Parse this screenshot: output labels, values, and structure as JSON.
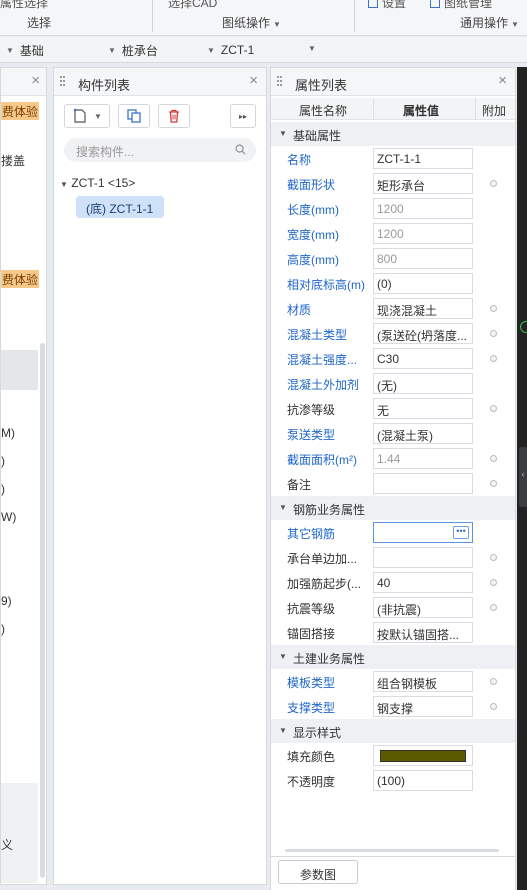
{
  "toolbar": {
    "cut_left": "属性选择",
    "cut_mid": "选择CAD",
    "cut_right1": "设置",
    "cut_right2": "图纸管理",
    "group_select": "选择",
    "group_drawing": "图纸操作",
    "group_general": "通用操作"
  },
  "selectors": {
    "sel1": "基础",
    "sel2": "桩承台",
    "sel3": "ZCT-1"
  },
  "left_panel": {
    "badge1": "费体验",
    "text1": "搂盖",
    "badge2": "费体验",
    "list": [
      "M)",
      ")",
      ")",
      "W)",
      "9)",
      ")"
    ],
    "bottom_text": "义"
  },
  "component_list": {
    "title": "构件列表",
    "search_placeholder": "搜索构件...",
    "tree_root": "ZCT-1 <15>",
    "tree_child": "(底) ZCT-1-1"
  },
  "property_list": {
    "title": "属性列表",
    "col_name": "属性名称",
    "col_value": "属性值",
    "col_extra": "附加",
    "rows": [
      {
        "type": "section",
        "title": "基础属性"
      },
      {
        "label": "名称",
        "value": "ZCT-1-1",
        "blue": true,
        "gray": false,
        "dot": false
      },
      {
        "label": "截面形状",
        "value": "矩形承台",
        "blue": true,
        "gray": false,
        "dot": true
      },
      {
        "label": "长度(mm)",
        "value": "1200",
        "blue": true,
        "gray": true,
        "dot": false
      },
      {
        "label": "宽度(mm)",
        "value": "1200",
        "blue": true,
        "gray": true,
        "dot": false
      },
      {
        "label": "高度(mm)",
        "value": "800",
        "blue": true,
        "gray": true,
        "dot": false
      },
      {
        "label": "相对底标高(m)",
        "value": "(0)",
        "blue": true,
        "gray": false,
        "dot": false
      },
      {
        "label": "材质",
        "value": "现浇混凝土",
        "blue": true,
        "gray": false,
        "dot": true
      },
      {
        "label": "混凝土类型",
        "value": "(泵送砼(坍落度...",
        "blue": true,
        "gray": false,
        "dot": true
      },
      {
        "label": "混凝土强度...",
        "value": "C30",
        "blue": true,
        "gray": false,
        "dot": true
      },
      {
        "label": "混凝土外加剂",
        "value": "(无)",
        "blue": true,
        "gray": false,
        "dot": false
      },
      {
        "label": "抗渗等级",
        "value": "无",
        "blue": false,
        "gray": false,
        "dot": true
      },
      {
        "label": "泵送类型",
        "value": "(混凝土泵)",
        "blue": true,
        "gray": false,
        "dot": false
      },
      {
        "label": "截面面积(m²)",
        "value": "1.44",
        "blue": true,
        "gray": true,
        "dot": true
      },
      {
        "label": "备注",
        "value": "",
        "blue": false,
        "gray": false,
        "dot": true
      },
      {
        "type": "section",
        "title": "钢筋业务属性"
      },
      {
        "label": "其它钢筋",
        "value": "",
        "blue": true,
        "gray": false,
        "dot": false,
        "active": true
      },
      {
        "label": "承台单边加...",
        "value": "",
        "blue": false,
        "gray": false,
        "dot": true
      },
      {
        "label": "加强筋起步(...",
        "value": "40",
        "blue": false,
        "gray": false,
        "dot": true
      },
      {
        "label": "抗震等级",
        "value": "(非抗震)",
        "blue": false,
        "gray": false,
        "dot": true
      },
      {
        "label": "锚固搭接",
        "value": "按默认锚固搭...",
        "blue": false,
        "gray": false,
        "dot": false
      },
      {
        "type": "section",
        "title": "土建业务属性"
      },
      {
        "label": "模板类型",
        "value": "组合钢模板",
        "blue": true,
        "gray": false,
        "dot": true
      },
      {
        "label": "支撑类型",
        "value": "钢支撑",
        "blue": true,
        "gray": false,
        "dot": true
      },
      {
        "type": "section",
        "title": "显示样式"
      },
      {
        "label": "填充颜色",
        "value": "",
        "blue": false,
        "gray": false,
        "dot": false,
        "swatch": true
      },
      {
        "label": "不透明度",
        "value": "(100)",
        "blue": false,
        "gray": false,
        "dot": false
      }
    ]
  },
  "param_button": "参数图",
  "colors": {
    "fill_color": "#5b5a00",
    "label_blue": "#1f66c8",
    "badge_orange": "#f6c98a"
  }
}
